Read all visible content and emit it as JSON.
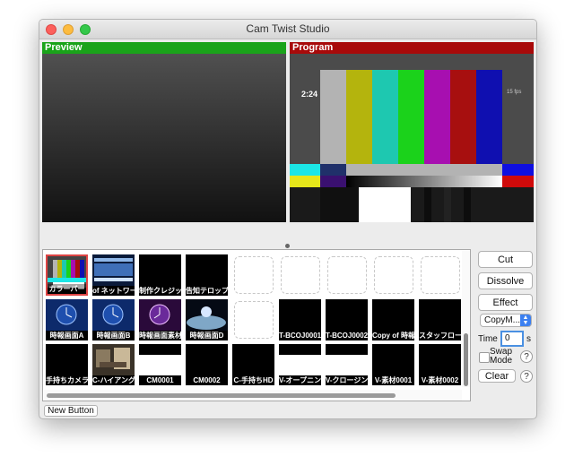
{
  "window": {
    "title": "Cam Twist Studio"
  },
  "preview": {
    "label": "Preview"
  },
  "program": {
    "label": "Program",
    "timestamp": "2:24",
    "overlay_text": "15 fps"
  },
  "tiles": [
    {
      "label": "カラーバー",
      "thumb": "colorbars",
      "selected": true
    },
    {
      "label": "of ネットワーク",
      "thumb": "network"
    },
    {
      "label": "制作クレジット",
      "thumb": "black"
    },
    {
      "label": "告知テロップ",
      "thumb": "black"
    },
    {
      "label": "",
      "thumb": "empty"
    },
    {
      "label": "",
      "thumb": "empty"
    },
    {
      "label": "",
      "thumb": "empty"
    },
    {
      "label": "",
      "thumb": "empty"
    },
    {
      "label": "",
      "thumb": "empty"
    },
    {
      "label": "時報画面A",
      "thumb": "clock-blue"
    },
    {
      "label": "時報画面B",
      "thumb": "clock-blue"
    },
    {
      "label": "時報画面素材C",
      "thumb": "clock-purple"
    },
    {
      "label": "時報画面D",
      "thumb": "planet"
    },
    {
      "label": "",
      "thumb": "empty"
    },
    {
      "label": "T-BCOJ0001",
      "thumb": "black"
    },
    {
      "label": "T-BCOJ0002",
      "thumb": "black"
    },
    {
      "label": "Copy of 時報音",
      "thumb": "black"
    },
    {
      "label": "スタッフロール",
      "thumb": "black"
    },
    {
      "label": "手持ちカメラ",
      "thumb": "black"
    },
    {
      "label": "C-ハイアングル",
      "thumb": "photo"
    },
    {
      "label": "CM0001",
      "thumb": "white"
    },
    {
      "label": "CM0002",
      "thumb": "black"
    },
    {
      "label": "C-手持ちHD",
      "thumb": "black"
    },
    {
      "label": "V-オープニング",
      "thumb": "white"
    },
    {
      "label": "V-クロージング",
      "thumb": "white"
    },
    {
      "label": "V-素材0001",
      "thumb": "black"
    },
    {
      "label": "V-素材0002",
      "thumb": "black"
    }
  ],
  "controls": {
    "cut": "Cut",
    "dissolve": "Dissolve",
    "effect": "Effect",
    "copy_select": "CopyM...",
    "time_label": "Time",
    "time_value": "0",
    "time_unit": "s",
    "swap_label": "Swap Mode",
    "help": "?",
    "clear": "Clear"
  },
  "footer": {
    "new_button": "New Button"
  },
  "colors": {
    "preview_green": "#1aa31a",
    "program_red": "#a80a0a",
    "focus_blue": "#4a90e2"
  },
  "icons": [
    "close-icon",
    "minimize-icon",
    "zoom-icon",
    "chevron-updown-icon",
    "help-icon"
  ]
}
